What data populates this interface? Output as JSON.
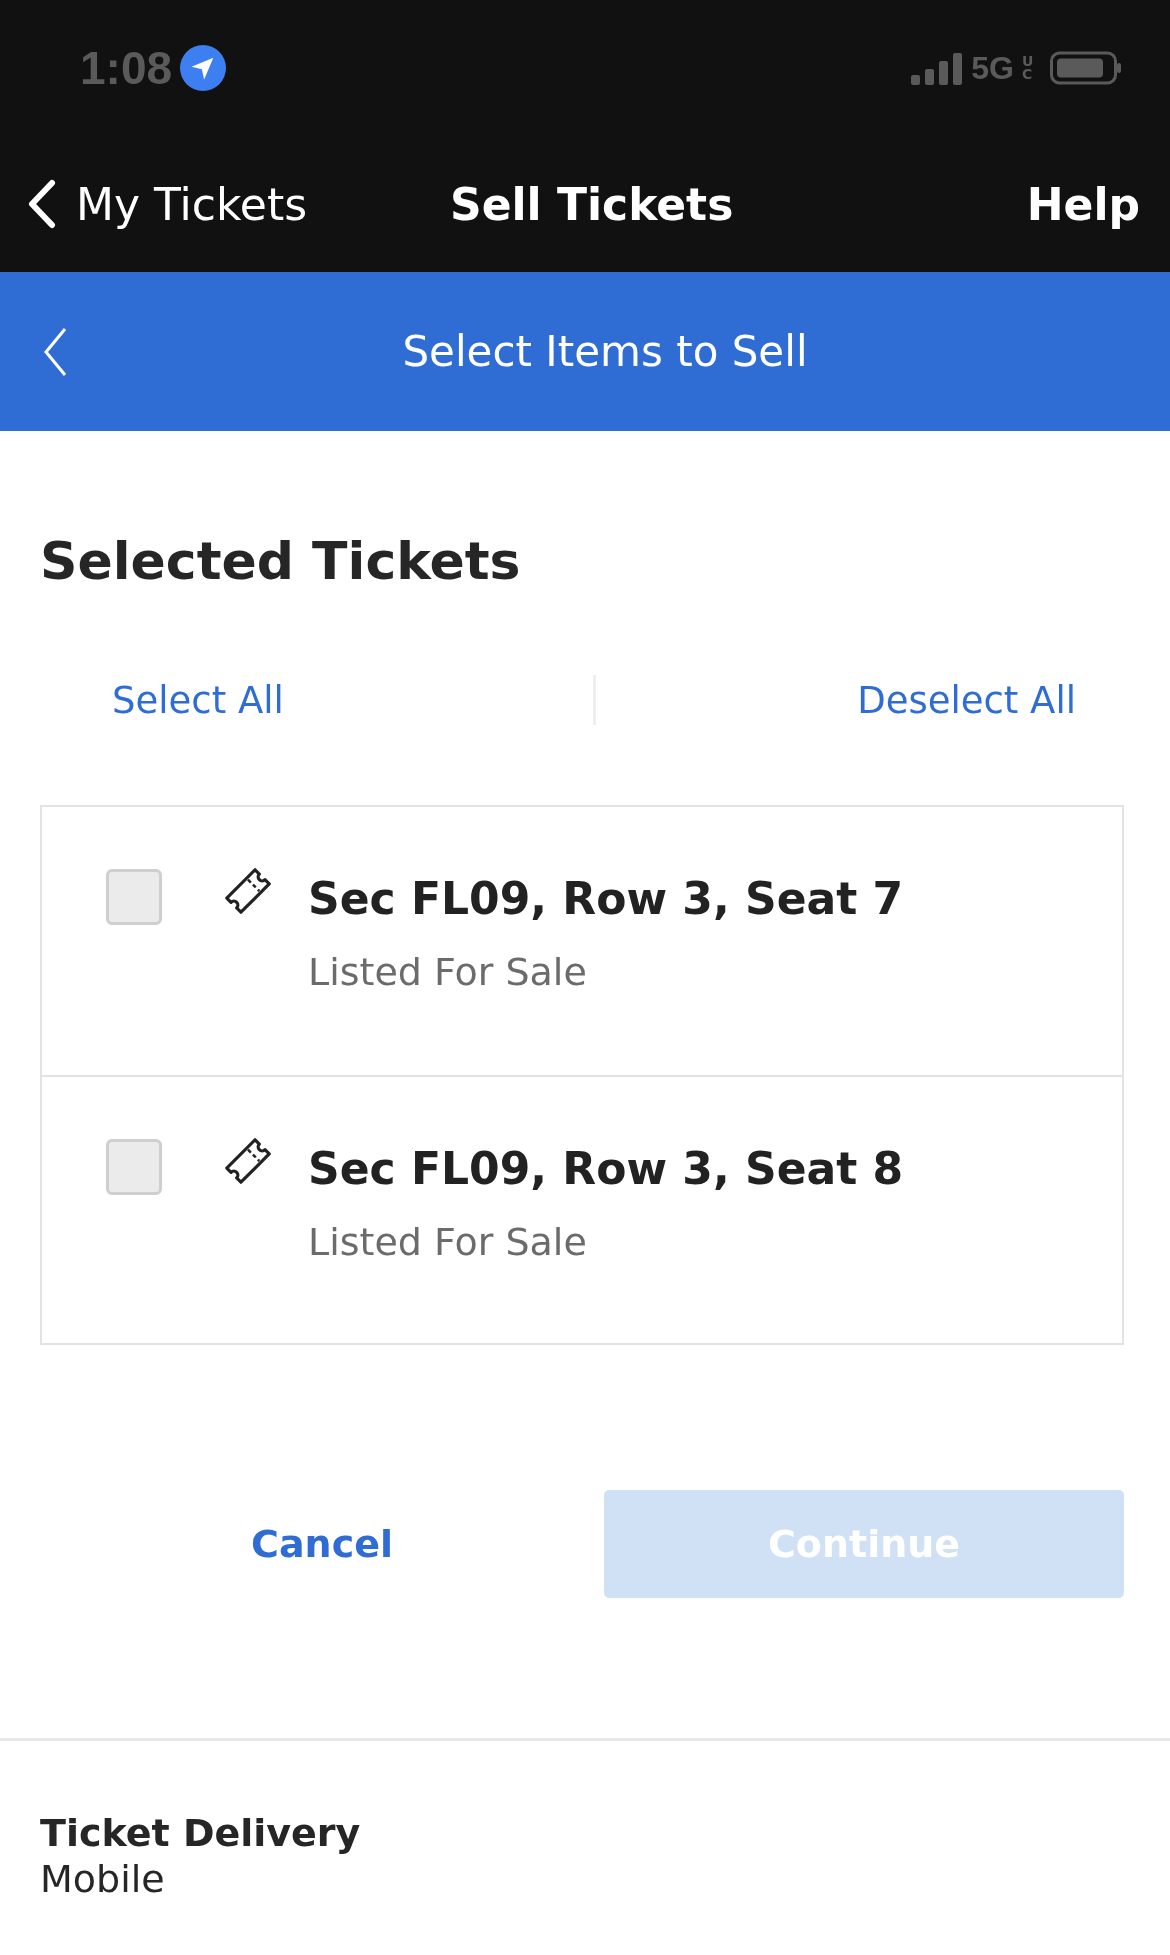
{
  "status_bar": {
    "time": "1:08",
    "network": "5G",
    "network_badge": "UC"
  },
  "nav": {
    "back_label": "My Tickets",
    "title": "Sell Tickets",
    "action": "Help"
  },
  "header": {
    "title": "Select Items to Sell"
  },
  "section": {
    "title": "Selected Tickets",
    "select_all": "Select All",
    "deselect_all": "Deselect All"
  },
  "tickets": [
    {
      "title": "Sec FL09, Row 3, Seat 7",
      "status": "Listed For Sale",
      "checked": false
    },
    {
      "title": "Sec FL09, Row 3, Seat 8",
      "status": "Listed For Sale",
      "checked": false
    }
  ],
  "actions": {
    "cancel": "Cancel",
    "continue": "Continue",
    "continue_disabled": true
  },
  "delivery": {
    "label": "Ticket Delivery",
    "value": "Mobile"
  }
}
